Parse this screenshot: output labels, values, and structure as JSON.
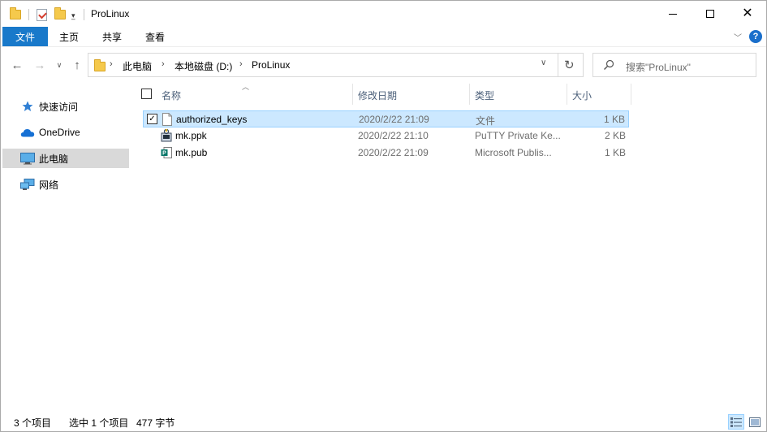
{
  "window": {
    "title": "ProLinux",
    "minimize_icon": "minimize-icon",
    "maximize_icon": "maximize-icon",
    "close_icon": "close-icon"
  },
  "quick_access_toolbar": {
    "icons": [
      "folder-icon",
      "properties-icon",
      "new-folder-icon",
      "customize-dropdown-icon"
    ]
  },
  "ribbon": {
    "tabs": [
      "文件",
      "主页",
      "共享",
      "查看"
    ],
    "accent_color": "#1979ca",
    "help_label": "?"
  },
  "navigation": {
    "back_icon": "back-arrow-icon",
    "forward_icon": "forward-arrow-icon",
    "recent_icon": "recent-dropdown-icon",
    "up_icon": "up-arrow-icon"
  },
  "address_bar": {
    "breadcrumbs": [
      "此电脑",
      "本地磁盘 (D:)",
      "ProLinux"
    ]
  },
  "search": {
    "placeholder": "搜索\"ProLinux\""
  },
  "sidebar": {
    "items": [
      {
        "label": "快速访问",
        "icon": "star-icon",
        "selected": false
      },
      {
        "label": "OneDrive",
        "icon": "cloud-icon",
        "selected": false
      },
      {
        "label": "此电脑",
        "icon": "computer-icon",
        "selected": true
      },
      {
        "label": "网络",
        "icon": "network-icon",
        "selected": false
      }
    ]
  },
  "file_list": {
    "columns": [
      "名称",
      "修改日期",
      "类型",
      "大小"
    ],
    "sort_column": "名称",
    "rows": [
      {
        "name": "authorized_keys",
        "date": "2020/2/22 21:09",
        "type": "文件",
        "size": "1 KB",
        "icon": "blank-file-icon",
        "selected": true,
        "checked": true
      },
      {
        "name": "mk.ppk",
        "date": "2020/2/22 21:10",
        "type": "PuTTY Private Ke...",
        "size": "2 KB",
        "icon": "putty-key-icon",
        "selected": false,
        "checked": false
      },
      {
        "name": "mk.pub",
        "date": "2020/2/22 21:09",
        "type": "Microsoft Publis...",
        "size": "1 KB",
        "icon": "publisher-icon",
        "selected": false,
        "checked": false
      }
    ],
    "selection_color": "#cce8ff"
  },
  "status_bar": {
    "item_count": "3 个项目",
    "selection": "选中 1 个项目",
    "size": "477 字节"
  }
}
